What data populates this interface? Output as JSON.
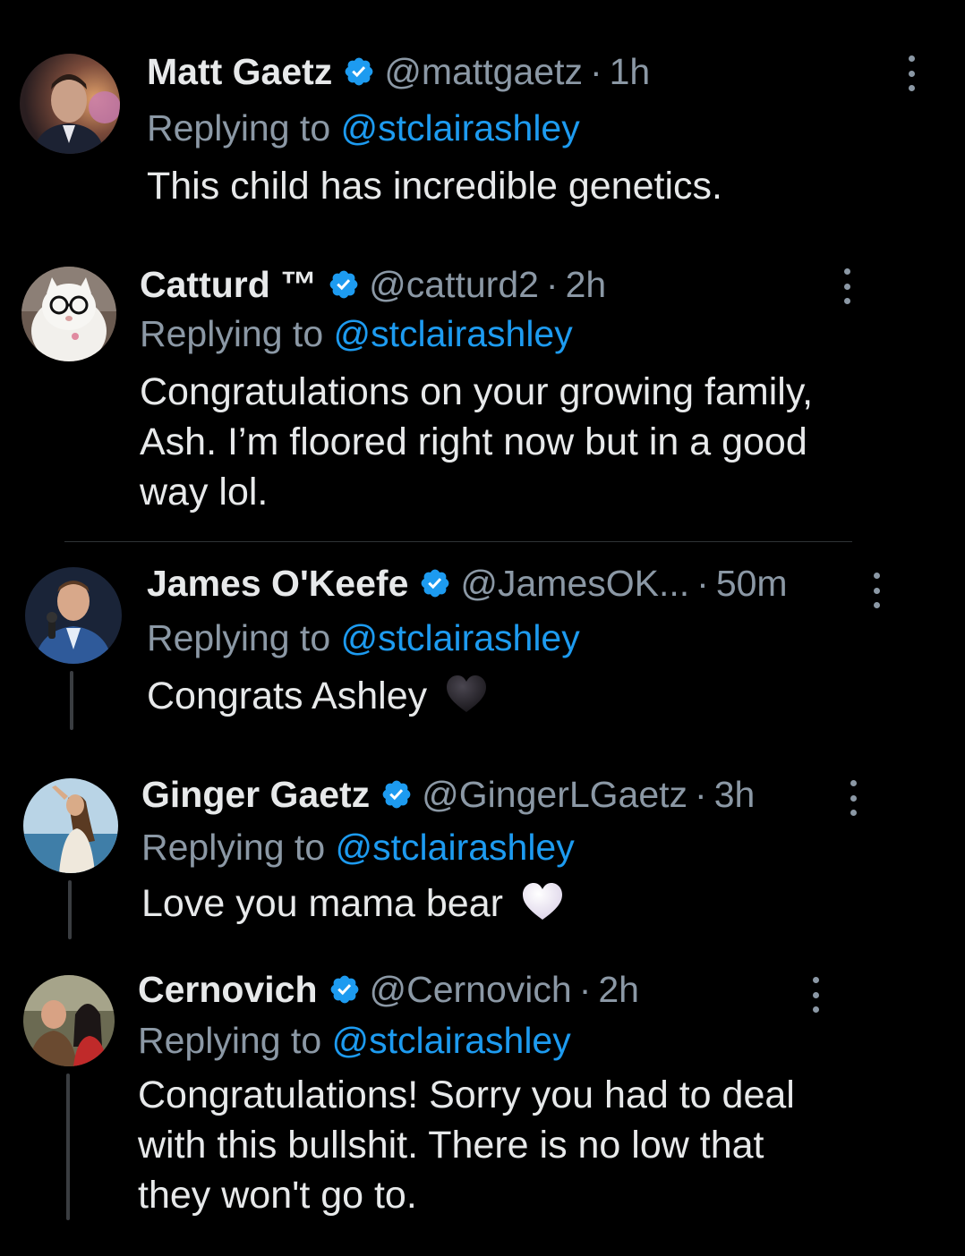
{
  "replying_prefix": "Replying to",
  "colors": {
    "background": "#000000",
    "text": "#e7e9ea",
    "secondary": "#8b98a5",
    "mention": "#1d9bf0",
    "verified": "#1d9bf0"
  },
  "replies": [
    {
      "display_name": "Matt Gaetz",
      "verified": true,
      "handle": "@mattgaetz",
      "separator": "·",
      "time": "1h",
      "replying_to": "@stclairashley",
      "text": "This child has incredible genetics.",
      "emoji": null,
      "more_icon": "more-vertical-icon"
    },
    {
      "display_name": "Catturd ™",
      "verified": true,
      "handle": "@catturd2",
      "separator": "·",
      "time": "2h",
      "replying_to": "@stclairashley",
      "text_lines": [
        "Congratulations on your growing family,",
        "Ash. I’m floored right now but in a good",
        "way lol."
      ],
      "emoji": null,
      "more_icon": "more-vertical-icon"
    },
    {
      "display_name": "James O'Keefe",
      "verified": true,
      "handle": "@JamesOK...",
      "separator": "·",
      "time": "50m",
      "replying_to": "@stclairashley",
      "text": "Congrats Ashley",
      "emoji": "black-heart",
      "more_icon": "more-vertical-icon"
    },
    {
      "display_name": "Ginger Gaetz",
      "verified": true,
      "handle": "@GingerLGaetz",
      "separator": "·",
      "time": "3h",
      "replying_to": "@stclairashley",
      "text": "Love you mama bear",
      "emoji": "white-heart",
      "more_icon": "more-vertical-icon"
    },
    {
      "display_name": "Cernovich",
      "verified": true,
      "handle": "@Cernovich",
      "separator": "·",
      "time": "2h",
      "replying_to": "@stclairashley",
      "text_lines": [
        "Congratulations! Sorry you had to deal",
        "with this bullshit. There is no low that",
        "they won't go to."
      ],
      "emoji": null,
      "more_icon": "more-vertical-icon"
    }
  ]
}
